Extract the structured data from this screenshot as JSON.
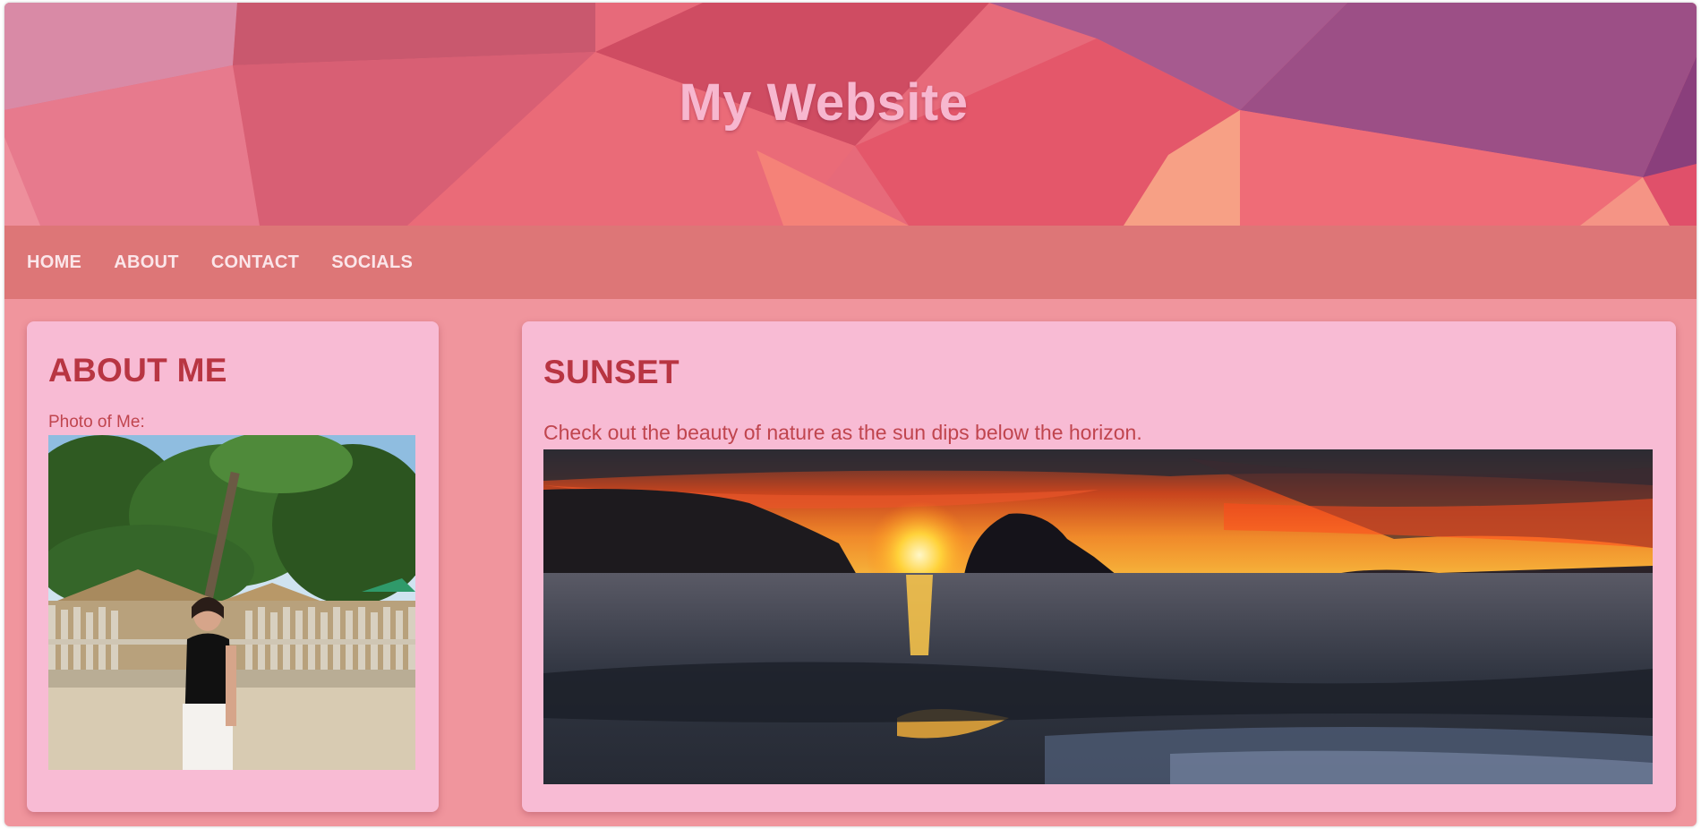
{
  "header": {
    "title": "My Website"
  },
  "nav": {
    "items": [
      "HOME",
      "ABOUT",
      "CONTACT",
      "SOCIALS"
    ]
  },
  "about": {
    "heading": "ABOUT ME",
    "photo_label": "Photo of Me:"
  },
  "post": {
    "heading": "SUNSET",
    "description": "Check out the beauty of nature as the sun dips below the horizon."
  },
  "colors": {
    "page_background": "#f0959d",
    "nav_background": "#dd7677",
    "card_background": "#f8bbd4",
    "heading_color": "#b83542",
    "title_color": "#f7b7cf"
  }
}
